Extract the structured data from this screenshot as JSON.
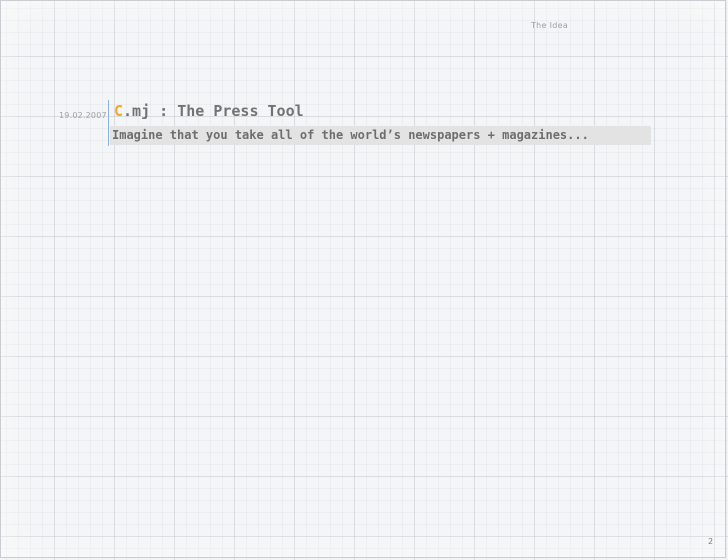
{
  "header": {
    "section_label": "The Idea"
  },
  "slide": {
    "date": "19.02.2007",
    "title_logo_letter": "C",
    "title_rest": ".mj : The Press Tool",
    "subtitle": "Imagine that you take all of the world’s newspapers + magazines...",
    "accent_color": "#f0a92a",
    "divider_color": "#8fb4e0"
  },
  "footer": {
    "page_number": "2"
  }
}
